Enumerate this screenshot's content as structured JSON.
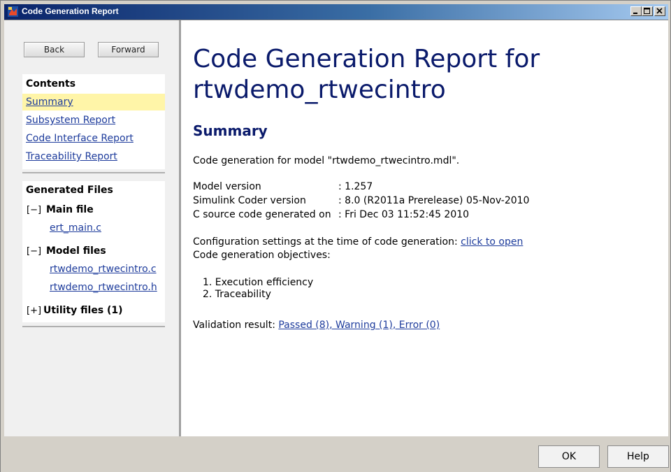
{
  "window": {
    "title": "Code Generation Report",
    "colors": {
      "titlebar": "#0a246a",
      "link": "#1e3c9c",
      "heading": "#0a1a6b",
      "highlight": "#fff5a8"
    }
  },
  "nav": {
    "back_label": "Back",
    "forward_label": "Forward"
  },
  "contents": {
    "heading": "Contents",
    "items": [
      {
        "label": "Summary",
        "active": true
      },
      {
        "label": "Subsystem Report"
      },
      {
        "label": "Code Interface Report"
      },
      {
        "label": "Traceability Report"
      }
    ]
  },
  "generated_files": {
    "heading": "Generated Files",
    "groups": [
      {
        "toggle": "[−]",
        "label": "Main file",
        "files": [
          "ert_main.c"
        ]
      },
      {
        "toggle": "[−]",
        "label": "Model files",
        "files": [
          "rtwdemo_rtwecintro.c",
          "rtwdemo_rtwecintro.h"
        ]
      },
      {
        "toggle": "[+]",
        "label": "Utility files (1)"
      }
    ]
  },
  "report": {
    "title_line1": "Code Generation Report for",
    "title_line2": "rtwdemo_rtwecintro",
    "section": "Summary",
    "intro": "Code generation for model \"rtwdemo_rtwecintro.mdl\".",
    "details": [
      {
        "key": "Model version",
        "value": ": 1.257"
      },
      {
        "key": "Simulink Coder version",
        "value": ": 8.0 (R2011a Prerelease) 05-Nov-2010"
      },
      {
        "key": "C source code generated on",
        "value": ": Fri Dec 03 11:52:45 2010"
      }
    ],
    "config_text": "Configuration settings at the time of code generation: ",
    "config_link": "click to open",
    "objectives_label": "Code generation objectives:",
    "objectives": [
      "1.  Execution efficiency",
      "2.  Traceability"
    ],
    "validation_text": "Validation result: ",
    "validation_link": "Passed (8), Warning (1), Error (0)"
  },
  "footer": {
    "ok_label": "OK",
    "help_label": "Help"
  },
  "icons": [
    "app-icon",
    "minimize-icon",
    "maximize-icon",
    "close-icon"
  ]
}
